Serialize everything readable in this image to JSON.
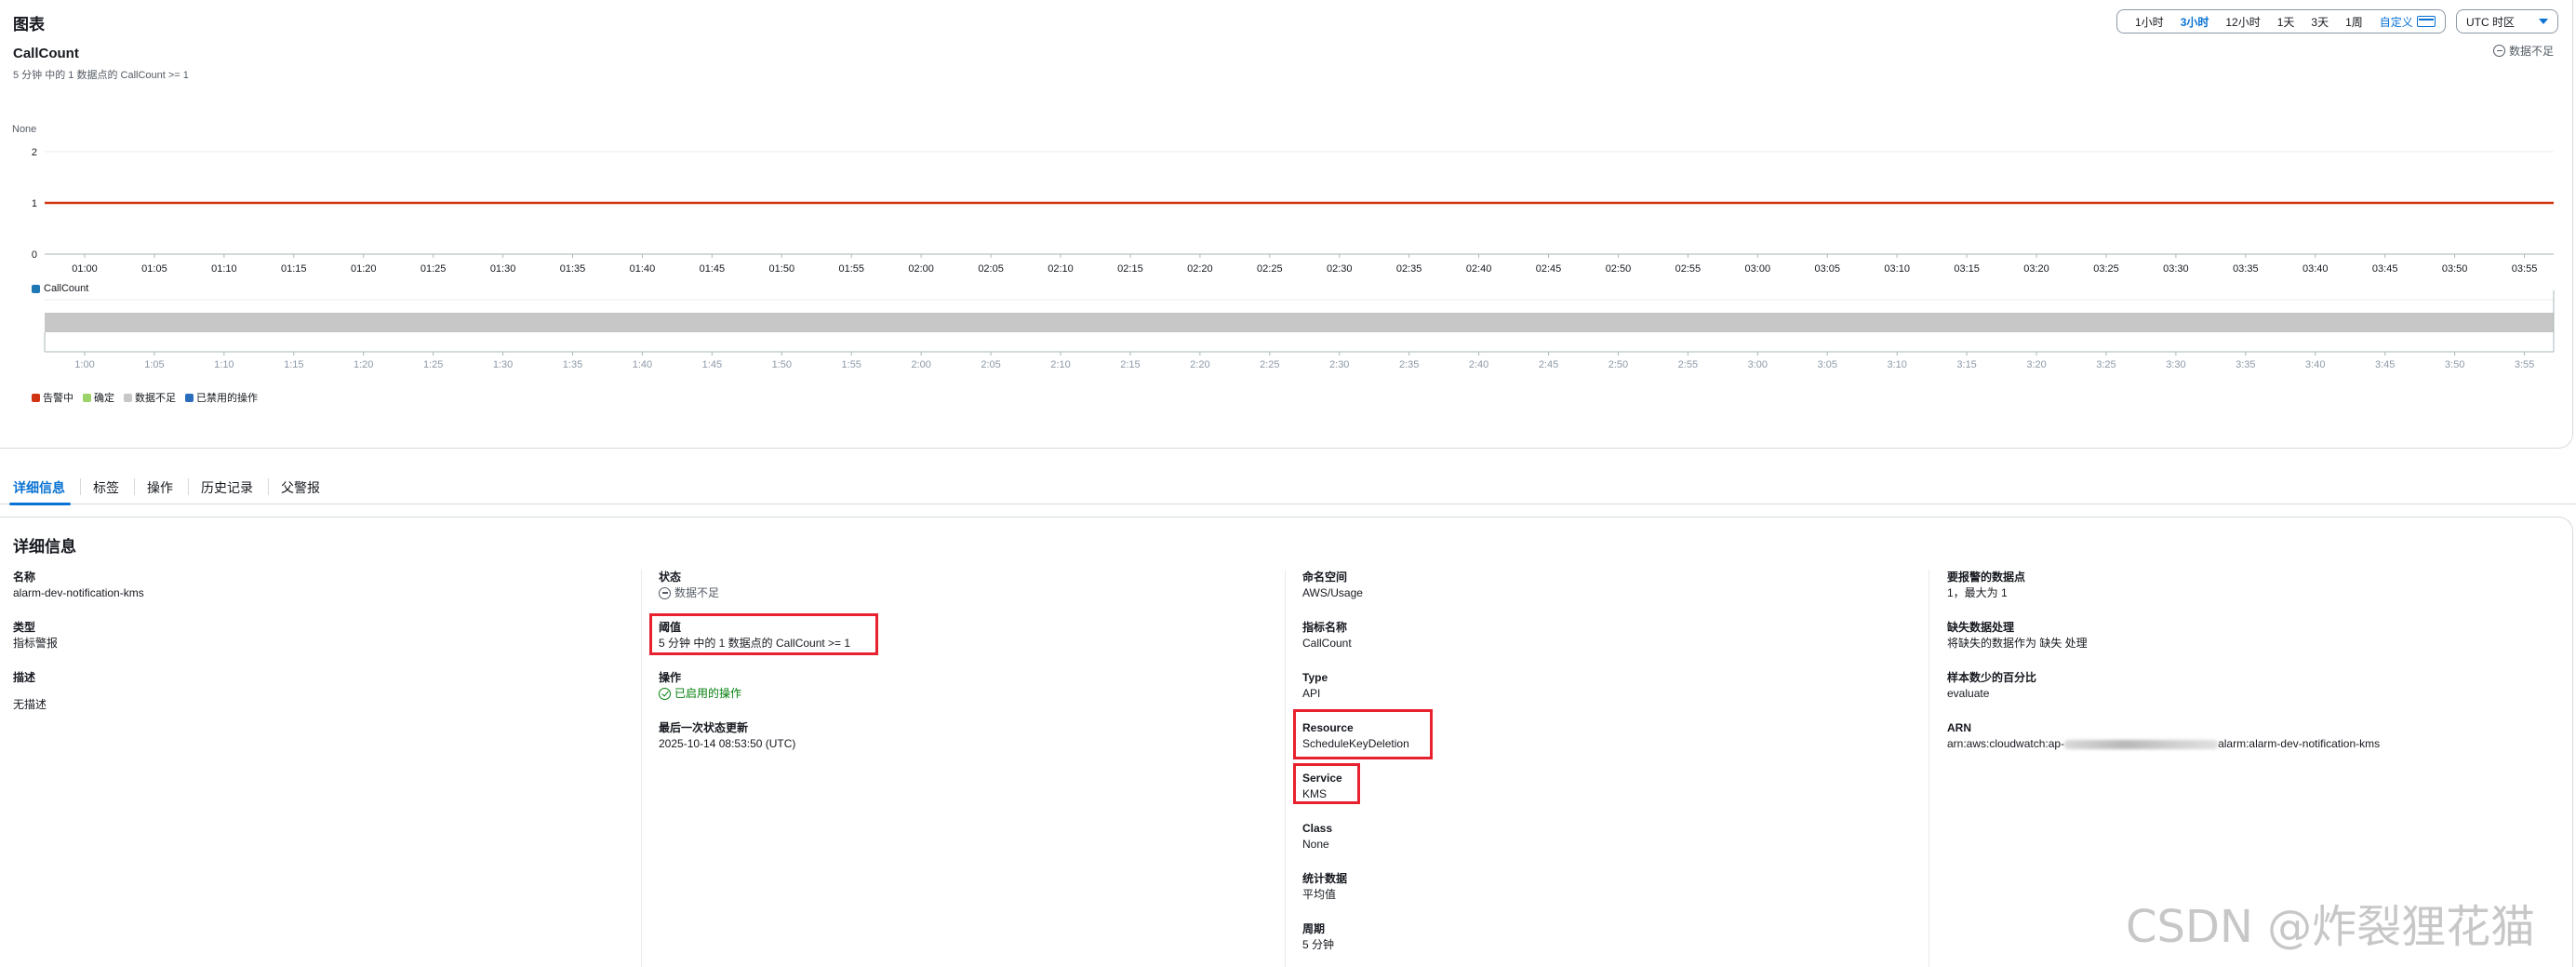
{
  "header": {
    "title": "图表"
  },
  "chart": {
    "title": "CallCount",
    "subtitle": "5 分钟 中的 1 数据点的 CallCount >= 1",
    "insufficient_label": "数据不足",
    "unit_label": "None"
  },
  "time_range": {
    "options": [
      "1小时",
      "3小时",
      "12小时",
      "1天",
      "3天",
      "1周"
    ],
    "active": "3小时",
    "custom_label": "自定义"
  },
  "timezone": {
    "label": "UTC 时区"
  },
  "colors": {
    "threshold": "#d13212",
    "series": "#1f77b4",
    "accent": "#0972d3",
    "alarm": "#d13212",
    "ok": "#9bd36a",
    "insufficient": "#c7c7c7",
    "disabled_actions": "#2a6dbb"
  },
  "chart_data": [
    {
      "type": "line",
      "title": "CallCount",
      "ylabel": "None",
      "ylim": [
        0,
        2
      ],
      "y_ticks": [
        "0",
        "1",
        "2"
      ],
      "x_ticks": [
        "01:00",
        "01:05",
        "01:10",
        "01:15",
        "01:20",
        "01:25",
        "01:30",
        "01:35",
        "01:40",
        "01:45",
        "01:50",
        "01:55",
        "02:00",
        "02:05",
        "02:10",
        "02:15",
        "02:20",
        "02:25",
        "02:30",
        "02:35",
        "02:40",
        "02:45",
        "02:50",
        "02:55",
        "03:00",
        "03:05",
        "03:10",
        "03:15",
        "03:20",
        "03:25",
        "03:30",
        "03:35",
        "03:40",
        "03:45",
        "03:50",
        "03:55"
      ],
      "threshold": 1,
      "series": [
        {
          "name": "CallCount",
          "values": []
        }
      ],
      "grid": true,
      "legend": "bottom-left"
    },
    {
      "type": "area",
      "x_ticks": [
        "1:00",
        "1:05",
        "1:10",
        "1:15",
        "1:20",
        "1:25",
        "1:30",
        "1:35",
        "1:40",
        "1:45",
        "1:50",
        "1:55",
        "2:00",
        "2:05",
        "2:10",
        "2:15",
        "2:20",
        "2:25",
        "2:30",
        "2:35",
        "2:40",
        "2:45",
        "2:50",
        "2:55",
        "3:00",
        "3:05",
        "3:10",
        "3:15",
        "3:20",
        "3:25",
        "3:30",
        "3:35",
        "3:40",
        "3:45",
        "3:50",
        "3:55"
      ],
      "state": "数据不足",
      "legend_items": [
        "告警中",
        "确定",
        "数据不足",
        "已禁用的操作"
      ],
      "legend": "bottom-left"
    }
  ],
  "tabs": [
    "详细信息",
    "标签",
    "操作",
    "历史记录",
    "父警报"
  ],
  "details": {
    "title": "详细信息",
    "col1": [
      {
        "k": "名称",
        "v": "alarm-dev-notification-kms"
      },
      {
        "k": "类型",
        "v": "指标警报"
      },
      {
        "k": "描述",
        "v": "无描述"
      }
    ],
    "col2": {
      "state_k": "状态",
      "state_v": "数据不足",
      "threshold_k": "阈值",
      "threshold_v": "5 分钟 中的 1 数据点的 CallCount >= 1",
      "actions_k": "操作",
      "actions_v": "已启用的操作",
      "last_update_k": "最后一次状态更新",
      "last_update_v": "2025-10-14 08:53:50 (UTC)"
    },
    "col3": [
      {
        "k": "命名空间",
        "v": "AWS/Usage"
      },
      {
        "k": "指标名称",
        "v": "CallCount"
      },
      {
        "k": "Type",
        "v": "API"
      },
      {
        "k": "Resource",
        "v": "ScheduleKeyDeletion"
      },
      {
        "k": "Service",
        "v": "KMS"
      },
      {
        "k": "Class",
        "v": "None"
      },
      {
        "k": "统计数据",
        "v": "平均值"
      },
      {
        "k": "周期",
        "v": "5 分钟"
      }
    ],
    "col4": {
      "dp_k": "要报警的数据点",
      "dp_v": "1，最大为 1",
      "missing_k": "缺失数据处理",
      "missing_v": "将缺失的数据作为 缺失 处理",
      "pct_k": "样本数少的百分比",
      "pct_v": "evaluate",
      "arn_k": "ARN",
      "arn_prefix": "arn:aws:cloudwatch:ap-",
      "arn_suffix": "alarm:alarm-dev-notification-kms"
    }
  },
  "watermark": "CSDN @炸裂狸花猫"
}
